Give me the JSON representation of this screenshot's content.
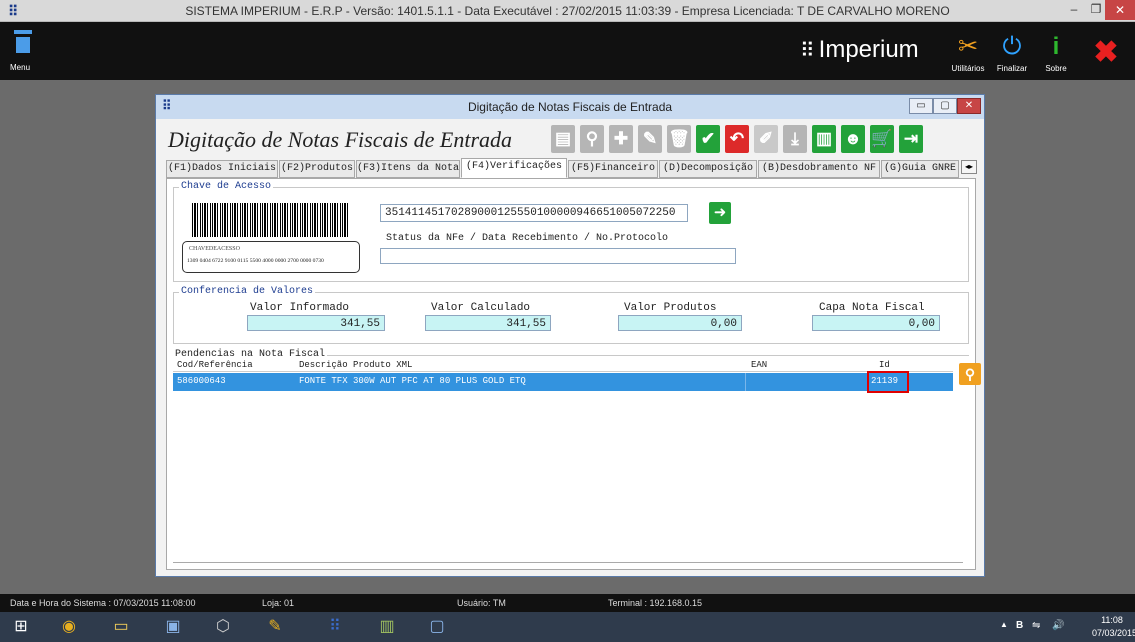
{
  "window": {
    "title": "SISTEMA IMPERIUM - E.R.P - Versão: 1401.5.1.1 - Data Executável : 27/02/2015 11:03:39 - Empresa Licenciada: T DE CARVALHO MORENO",
    "app_glyph": "⠿",
    "min_glyph": "–",
    "max_glyph": "❐",
    "close_glyph": "✕"
  },
  "header": {
    "menu_label": "Menu",
    "brand": "Imperium",
    "brand_glyph": "⠿",
    "tools": [
      {
        "label": "Utilitários",
        "icon": "wrench-icon",
        "glyph": "✂"
      },
      {
        "label": "Finalizar",
        "icon": "power-icon",
        "glyph": "⏻"
      },
      {
        "label": "Sobre",
        "icon": "info-icon",
        "glyph": "i"
      }
    ],
    "close_glyph": "✖"
  },
  "dialog": {
    "title": "Digitação de Notas Fiscais de Entrada",
    "heading": "Digitação de Notas Fiscais de Entrada",
    "glyph": "⠿",
    "min_glyph": "▭",
    "max_glyph": "▢",
    "close_glyph": "✕",
    "toolbar": [
      {
        "name": "document-icon",
        "glyph": "▤",
        "style": "gray"
      },
      {
        "name": "search-icon",
        "glyph": "⚲",
        "style": "gray"
      },
      {
        "name": "add-icon",
        "glyph": "✚",
        "style": "gray"
      },
      {
        "name": "edit-icon",
        "glyph": "✎",
        "style": "gray"
      },
      {
        "name": "delete-icon",
        "glyph": "🗑",
        "style": "gray"
      },
      {
        "name": "confirm-icon",
        "glyph": "✔",
        "style": "green"
      },
      {
        "name": "undo-icon",
        "glyph": "↶",
        "style": "red"
      },
      {
        "name": "clear-icon",
        "glyph": "✐",
        "style": "gray-lt"
      },
      {
        "name": "import-icon",
        "glyph": "⤓",
        "style": "gray"
      },
      {
        "name": "factory-icon",
        "glyph": "▥",
        "style": "green"
      },
      {
        "name": "user-icon",
        "glyph": "☻",
        "style": "green"
      },
      {
        "name": "cart-icon",
        "glyph": "🛒",
        "style": "green"
      },
      {
        "name": "exit-icon",
        "glyph": "⇥",
        "style": "green"
      }
    ],
    "tabs": [
      {
        "label": "(F1)Dados Iniciais"
      },
      {
        "label": "(F2)Produtos"
      },
      {
        "label": "(F3)Itens da Nota"
      },
      {
        "label": "(F4)Verificações",
        "active": true
      },
      {
        "label": "(F5)Financeiro"
      },
      {
        "label": "(D)Decomposição"
      },
      {
        "label": "(B)Desdobramento NF"
      },
      {
        "label": "(G)Guia GNRE"
      }
    ],
    "tab_scroll_glyph": "◂▸",
    "chave": {
      "legend": "Chave de Acesso",
      "barcode_caption": "CHAVEDEACESSO",
      "barcode_number": "1309 0404 6722 9100 0115 5500 4000 0000 2700 0000 0730",
      "key_value": "35141145170289000125550100000946651005072250",
      "go_glyph": "➜",
      "status_label": "Status da NFe / Data Recebimento / No.Protocolo",
      "status_value": ""
    },
    "conferencia": {
      "legend": "Conferencia de Valores",
      "fields": [
        {
          "label": "Valor Informado",
          "value": "341,55"
        },
        {
          "label": "Valor Calculado",
          "value": "341,55"
        },
        {
          "label": "Valor Produtos",
          "value": "0,00"
        },
        {
          "label": "Capa Nota Fiscal",
          "value": "0,00"
        }
      ]
    },
    "pendencias": {
      "legend": "Pendencias na Nota Fiscal",
      "columns": [
        "Cod/Referência",
        "Descrição Produto XML",
        "EAN",
        "Id"
      ],
      "rows": [
        {
          "cod": "586000643",
          "descricao": "FONTE TFX 300W AUT PFC AT 80 PLUS GOLD ETQ",
          "ean": "",
          "id": "21139"
        }
      ],
      "search_glyph": "⚲"
    }
  },
  "statusbar": {
    "datetime": "Data e Hora do Sistema :  07/03/2015 11:08:00",
    "loja": "Loja:  01",
    "usuario": "Usuário:  TM",
    "terminal": "Terminal :  192.168.0.15"
  },
  "taskbar": {
    "apps": [
      {
        "name": "start-icon",
        "glyph": "⊞",
        "color": "#ffffff"
      },
      {
        "name": "chrome-icon",
        "glyph": "◉",
        "color": "#e8b020"
      },
      {
        "name": "file-explorer-icon",
        "glyph": "▭",
        "color": "#f3cf5a"
      },
      {
        "name": "network-icon",
        "glyph": "▣",
        "color": "#8ab4e8"
      },
      {
        "name": "virtualbox-icon",
        "glyph": "⬡",
        "color": "#cccccc"
      },
      {
        "name": "tools-icon",
        "glyph": "✎",
        "color": "#e8b020"
      },
      {
        "name": "imperium-icon",
        "glyph": "⠿",
        "color": "#3a6ed0"
      },
      {
        "name": "chart-app-icon",
        "glyph": "▥",
        "color": "#a0c060"
      },
      {
        "name": "remote-desktop-icon",
        "glyph": "▢",
        "color": "#8ab4e8"
      }
    ],
    "tray_up": "▲",
    "tray_lang": "B",
    "tray_network": "⇋",
    "tray_volume": "🔊",
    "time": "11:08",
    "date": "07/03/2015"
  }
}
